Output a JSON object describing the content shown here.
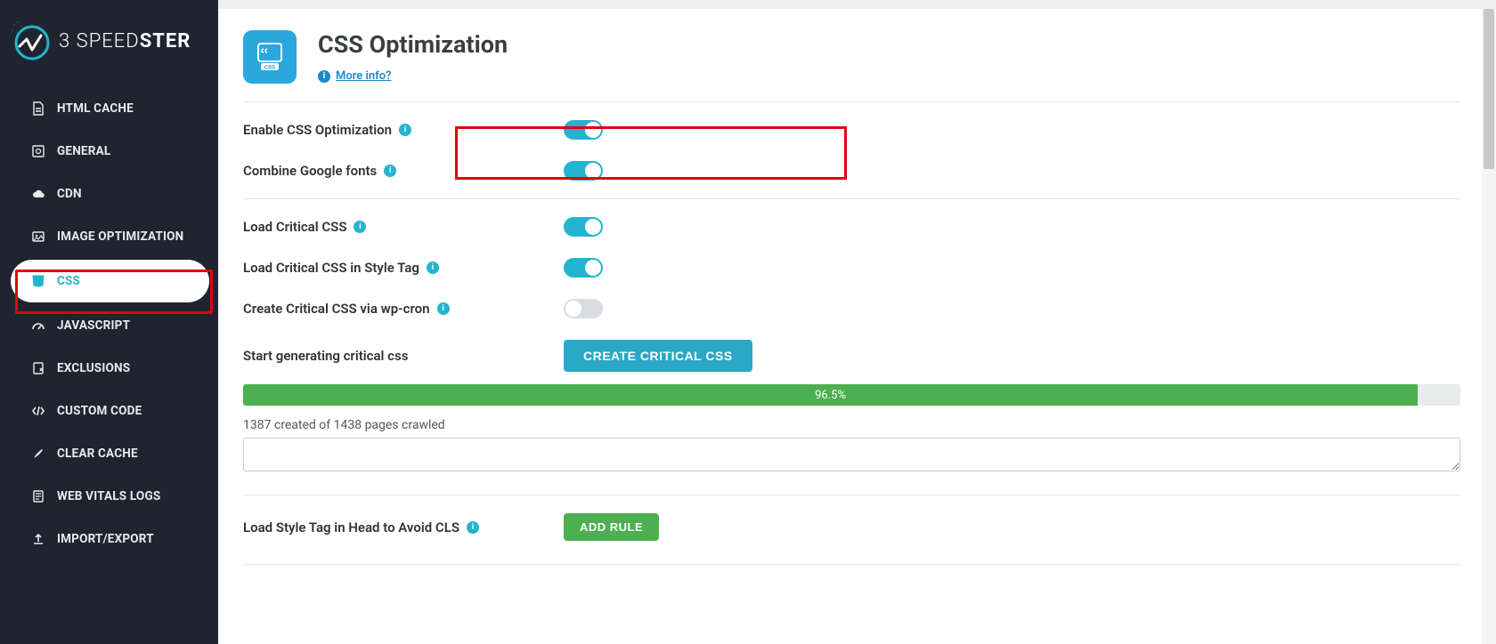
{
  "brand": {
    "prefix": "3",
    "light": "SPEED",
    "bold": "STER"
  },
  "sidebar": {
    "items": [
      {
        "label": "HTML CACHE"
      },
      {
        "label": "GENERAL"
      },
      {
        "label": "CDN"
      },
      {
        "label": "IMAGE OPTIMIZATION"
      },
      {
        "label": "CSS"
      },
      {
        "label": "JAVASCRIPT"
      },
      {
        "label": "EXCLUSIONS"
      },
      {
        "label": "CUSTOM CODE"
      },
      {
        "label": "CLEAR CACHE"
      },
      {
        "label": "WEB VITALS LOGS"
      },
      {
        "label": "IMPORT/EXPORT"
      }
    ]
  },
  "page": {
    "title": "CSS Optimization",
    "more_info": "More info?"
  },
  "settings": {
    "enable_css": {
      "label": "Enable CSS Optimization",
      "on": true
    },
    "combine_google_fonts": {
      "label": "Combine Google fonts",
      "on": true
    },
    "load_critical_css": {
      "label": "Load Critical CSS",
      "on": true
    },
    "load_critical_css_style_tag": {
      "label": "Load Critical CSS in Style Tag",
      "on": true
    },
    "create_critical_wpcron": {
      "label": "Create Critical CSS via wp-cron",
      "on": false
    },
    "start_generating": {
      "label": "Start generating critical css",
      "button": "CREATE CRITICAL CSS"
    },
    "progress": {
      "percent": 96.5,
      "display": "96.5%"
    },
    "status": "1387 created of 1438 pages crawled",
    "load_style_head": {
      "label": "Load Style Tag in Head to Avoid CLS",
      "button": "ADD RULE"
    }
  }
}
